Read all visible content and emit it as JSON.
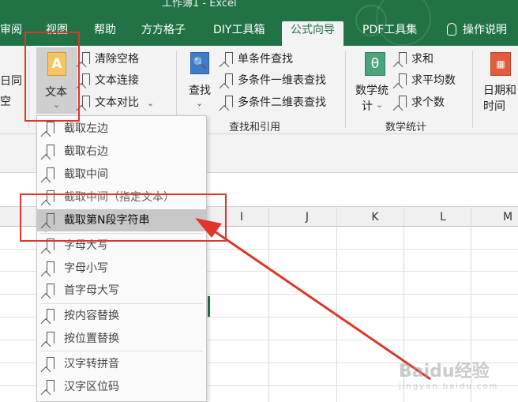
{
  "window": {
    "title": "工作簿1 - Excel"
  },
  "tabs": [
    {
      "label": "审阅"
    },
    {
      "label": "视图"
    },
    {
      "label": "帮助"
    },
    {
      "label": "方方格子"
    },
    {
      "label": "DIY工具箱"
    },
    {
      "label": "公式向导"
    },
    {
      "label": "PDF工具集"
    },
    {
      "label": "操作说明"
    }
  ],
  "ribbon": {
    "cutoff_left_top": "日同",
    "cutoff_left_bottom": "空",
    "text_group": {
      "big_button": "文本",
      "items": [
        "清除空格",
        "文本连接",
        "文本对比"
      ]
    },
    "find_group": {
      "big_button": "查找",
      "items": [
        "单条件查找",
        "多条件一维表查找",
        "多条件二维表查找"
      ],
      "label": "查找和引用"
    },
    "math_group": {
      "big_button_line1": "数学统",
      "big_button_line2": "计",
      "items": [
        "求和",
        "求平均数",
        "求个数"
      ],
      "label": "数学统计"
    },
    "date_group": {
      "big_button_line1": "日期和",
      "big_button_line2": "时间"
    }
  },
  "columns": [
    "I",
    "J",
    "K",
    "L",
    "M"
  ],
  "dropdown": {
    "items": [
      "截取左边",
      "截取右边",
      "截取中间",
      "截取中间（指定文本）",
      "截取第N段字符串",
      "字母大写",
      "字母小写",
      "首字母大写",
      "按内容替换",
      "按位置替换",
      "汉字转拼音",
      "汉字区位码"
    ],
    "highlighted_index": 4
  },
  "watermark": {
    "text": "Baidu经验",
    "sub": "jingyan.baidu.com"
  },
  "colors": {
    "excel_green": "#217346",
    "annotation_red": "#e0352b",
    "hover_gray": "#c7c7c7"
  }
}
